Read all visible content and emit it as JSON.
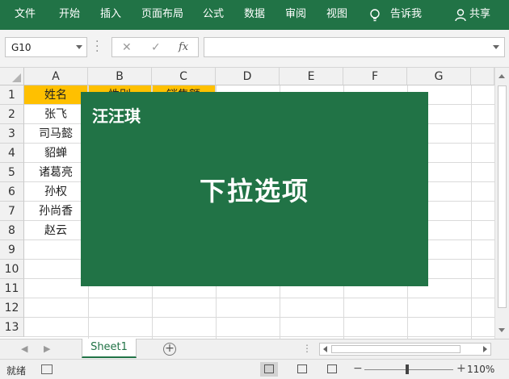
{
  "ribbon": {
    "tabs": [
      "文件",
      "开始",
      "插入",
      "页面布局",
      "公式",
      "数据",
      "审阅",
      "视图"
    ],
    "tell_me": "告诉我",
    "share": "共享",
    "bulb_icon": "lightbulb-icon",
    "share_icon": "person-icon"
  },
  "formula_bar": {
    "name_box": "G10",
    "cancel_glyph": "✕",
    "enter_glyph": "✓",
    "fx_label": "fx",
    "value": ""
  },
  "columns": [
    "A",
    "B",
    "C",
    "D",
    "E",
    "F",
    "G"
  ],
  "rows": [
    "1",
    "2",
    "3",
    "4",
    "5",
    "6",
    "7",
    "8",
    "9",
    "10",
    "11",
    "12",
    "13"
  ],
  "table": {
    "header": [
      "姓名",
      "性别",
      "销售额"
    ],
    "names": [
      "张飞",
      "司马懿",
      "貂蝉",
      "诸葛亮",
      "孙权",
      "孙尚香",
      "赵云"
    ]
  },
  "overlay": {
    "brand": "汪汪琪",
    "title": "下拉选项"
  },
  "sheets": {
    "active": "Sheet1",
    "add_glyph": "+"
  },
  "status": {
    "ready": "就绪",
    "zoom": "110%",
    "zoom_fraction": 1.1
  },
  "colors": {
    "ribbon": "#217346",
    "header_fill": "#ffc000",
    "overlay": "#217346"
  }
}
